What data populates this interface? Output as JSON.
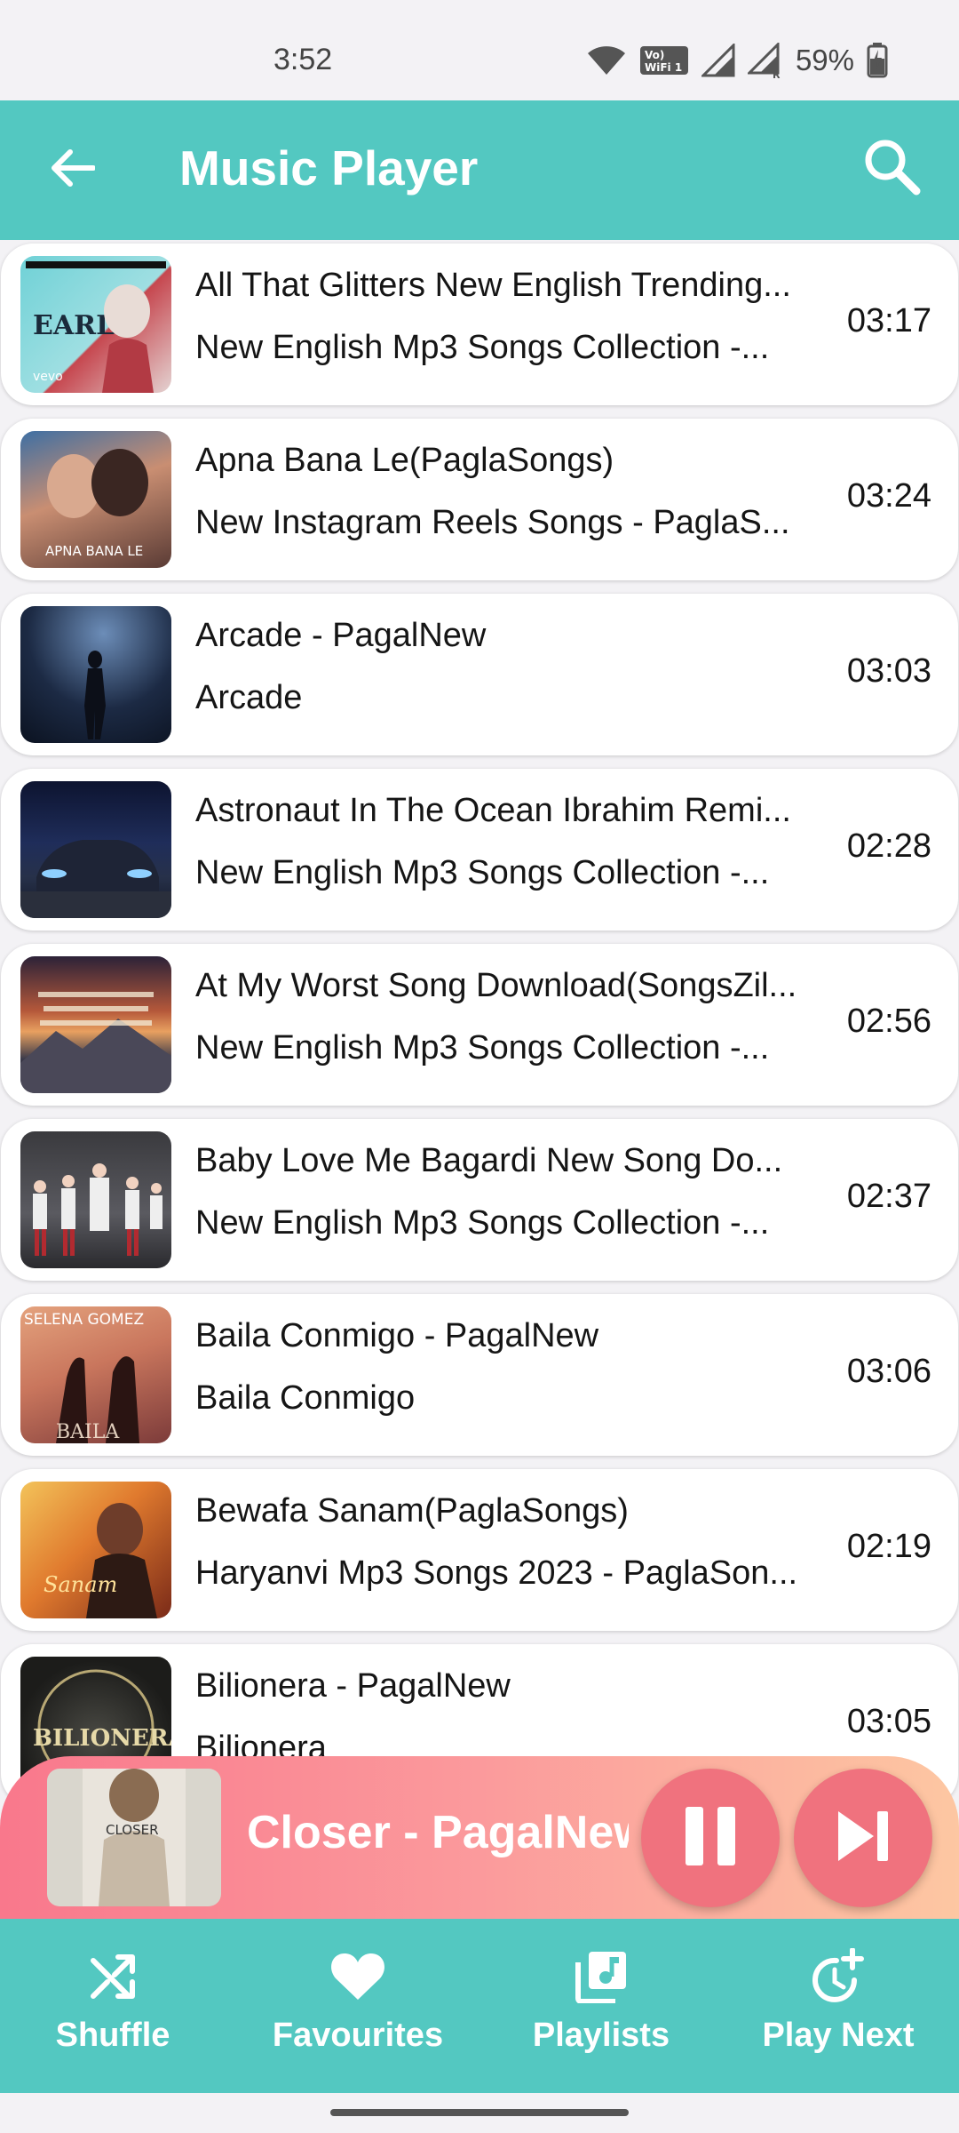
{
  "status_bar": {
    "time": "3:52",
    "battery": "59%",
    "icons": [
      "wifi-icon",
      "vowifi-icon",
      "signal-icon",
      "signal-roaming-icon",
      "battery-charging-icon"
    ]
  },
  "app_bar": {
    "title": "Music Player",
    "back_icon": "arrow-back-icon",
    "search_icon": "search-icon",
    "color": "#53c8c1"
  },
  "songs": [
    {
      "title": "All That Glitters New English Trending...",
      "subtitle": "New English Mp3 Songs Collection -...",
      "duration": "03:17",
      "art": "EARL"
    },
    {
      "title": "Apna Bana Le(PaglaSongs)",
      "subtitle": "New Instagram Reels Songs  - PaglaS...",
      "duration": "03:24",
      "art": "APNA BANA LE"
    },
    {
      "title": "Arcade - PagalNew",
      "subtitle": "Arcade",
      "duration": "03:03",
      "art": ""
    },
    {
      "title": "Astronaut In The Ocean Ibrahim Remi...",
      "subtitle": "New English Mp3 Songs Collection -...",
      "duration": "02:28",
      "art": ""
    },
    {
      "title": "At My Worst Song Download(SongsZil...",
      "subtitle": "New English Mp3 Songs Collection -...",
      "duration": "02:56",
      "art": ""
    },
    {
      "title": "Baby Love Me Bagardi New Song Do...",
      "subtitle": "New English Mp3 Songs Collection -...",
      "duration": "02:37",
      "art": ""
    },
    {
      "title": "Baila Conmigo - PagalNew",
      "subtitle": "Baila Conmigo",
      "duration": "03:06",
      "art": "SELENA GOMEZ"
    },
    {
      "title": "Bewafa Sanam(PaglaSongs)",
      "subtitle": "Haryanvi Mp3 Songs 2023 - PaglaSon...",
      "duration": "02:19",
      "art": "Sanam"
    },
    {
      "title": "Bilionera - PagalNew",
      "subtitle": "Bilionera",
      "duration": "03:05",
      "art": "BILIONERA"
    }
  ],
  "mini_player": {
    "title": "Closer - PagalNew",
    "art": "CLOSER",
    "pause_icon": "pause-icon",
    "next_icon": "skip-next-icon"
  },
  "bottom_nav": [
    {
      "label": "Shuffle",
      "icon": "shuffle-icon"
    },
    {
      "label": "Favourites",
      "icon": "heart-icon"
    },
    {
      "label": "Playlists",
      "icon": "playlist-icon"
    },
    {
      "label": "Play Next",
      "icon": "play-next-icon"
    }
  ]
}
